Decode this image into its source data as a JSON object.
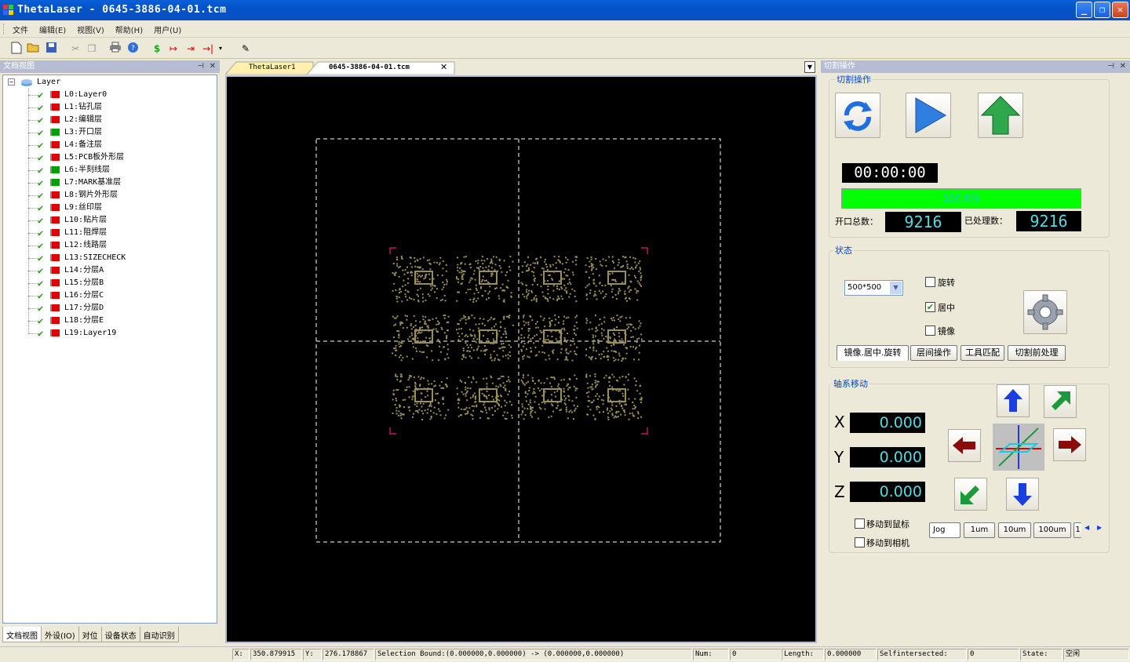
{
  "window": {
    "title": "ThetaLaser - 0645-3886-04-01.tcm"
  },
  "menu": [
    "文件",
    "编辑(E)",
    "视图(V)",
    "帮助(H)",
    "用户(U)"
  ],
  "left_panel": {
    "title": "文档视图",
    "root": "Layer",
    "layers": [
      {
        "label": "L0:Layer0",
        "flag": "red"
      },
      {
        "label": "L1:钻孔层",
        "flag": "red"
      },
      {
        "label": "L2:编辑层",
        "flag": "red"
      },
      {
        "label": "L3:开口层",
        "flag": "green"
      },
      {
        "label": "L4:备注层",
        "flag": "red"
      },
      {
        "label": "L5:PCB板外形层",
        "flag": "red"
      },
      {
        "label": "L6:半刻线层",
        "flag": "green"
      },
      {
        "label": "L7:MARK基准层",
        "flag": "green"
      },
      {
        "label": "L8:钢片外形层",
        "flag": "red"
      },
      {
        "label": "L9:丝印层",
        "flag": "red"
      },
      {
        "label": "L10:贴片层",
        "flag": "red"
      },
      {
        "label": "L11:阻焊层",
        "flag": "red"
      },
      {
        "label": "L12:线路层",
        "flag": "red"
      },
      {
        "label": "L13:SIZECHECK",
        "flag": "red"
      },
      {
        "label": "L14:分层A",
        "flag": "red"
      },
      {
        "label": "L15:分层B",
        "flag": "red"
      },
      {
        "label": "L16:分层C",
        "flag": "red"
      },
      {
        "label": "L17:分层D",
        "flag": "red"
      },
      {
        "label": "L18:分层E",
        "flag": "red"
      },
      {
        "label": "L19:Layer19",
        "flag": "red"
      }
    ],
    "tabs": [
      "文档视图",
      "外设(IO)",
      "对位",
      "设备状态",
      "自动识别"
    ]
  },
  "doc_tabs": [
    "ThetaLaser1",
    "0645-3886-04-01.tcm"
  ],
  "right_panel": {
    "title": "切割操作",
    "cut_group": {
      "title": "切割操作",
      "timer": "00:00:00",
      "progress_text": "100.0%",
      "progress": 1.0,
      "total_label": "开口总数：",
      "total_value": "9216",
      "processed_label": "已处理数：",
      "processed_value": "9216"
    },
    "status_group": {
      "title": "状态",
      "size_select": "500*500",
      "rotate_label": "旋转",
      "rotate_checked": false,
      "center_label": "居中",
      "center_checked": true,
      "mirror_label": "镜像",
      "mirror_checked": false,
      "tabs": [
        "镜像.居中.旋转",
        "层间操作",
        "工具匹配",
        "切割前处理"
      ]
    },
    "axis_group": {
      "title": "轴系移动",
      "x_label": "X",
      "x_value": "0.000",
      "y_label": "Y",
      "y_value": "0.000",
      "z_label": "Z",
      "z_value": "0.000",
      "move_mouse_label": "移动到鼠标",
      "move_camera_label": "移动到相机",
      "step_tabs": [
        "Jog",
        "1um",
        "10um",
        "100um",
        "1"
      ]
    }
  },
  "statusbar": {
    "x_label": "X:",
    "x_value": "350.879915",
    "y_label": "Y:",
    "y_value": "276.178867",
    "selection": "Selection Bound:(0.000000,0.000000) -> (0.000000,0.000000)",
    "num_label": "Num:",
    "num_value": "0",
    "length_label": "Length:",
    "length_value": "0.000000",
    "self_label": "Selfintersected:",
    "self_value": "0",
    "state_label": "State:",
    "state_value": "空闲"
  },
  "colors": {
    "pcb": "#9a8f5a",
    "marker": "#e0207a",
    "progress": "#00ff00",
    "lcd_text": "#59d8e0"
  }
}
